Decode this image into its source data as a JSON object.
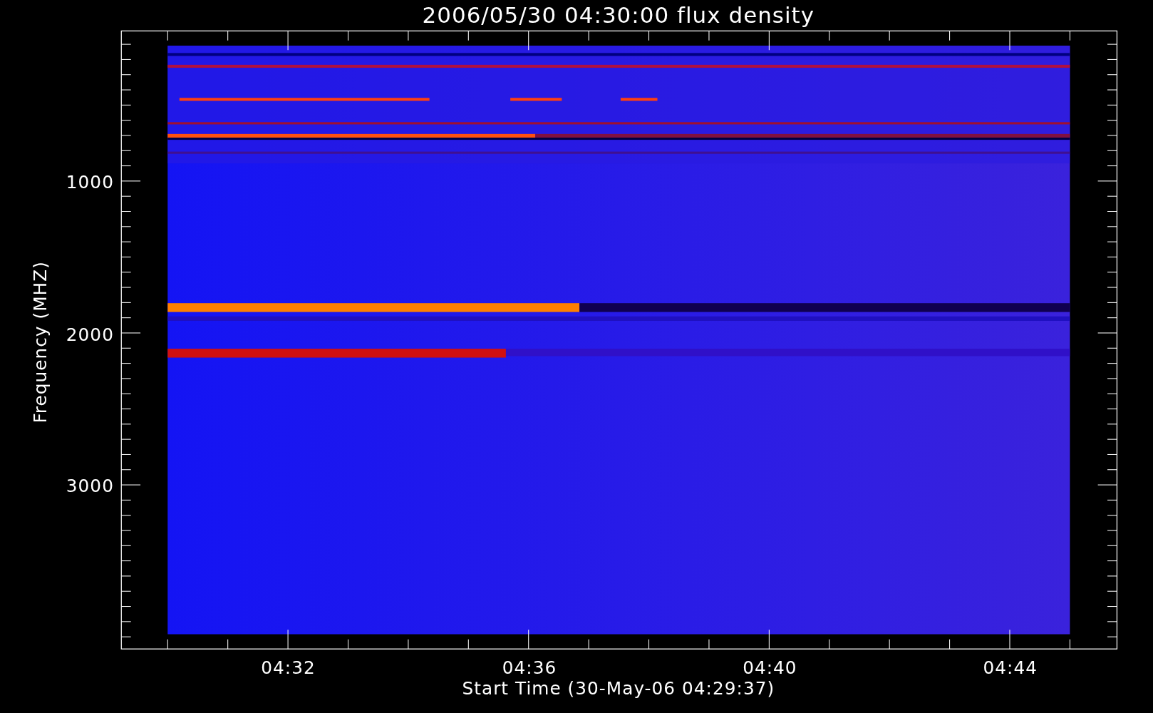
{
  "plot": {
    "title": "2006/05/30 04:30:00 flux density",
    "xlabel": "Start Time (30-May-06 04:29:37)",
    "ylabel": "Frequency (MHZ)",
    "xticks": [
      "04:32",
      "04:36",
      "04:40",
      "04:44"
    ],
    "yticks": [
      "1000",
      "2000",
      "3000"
    ]
  }
}
